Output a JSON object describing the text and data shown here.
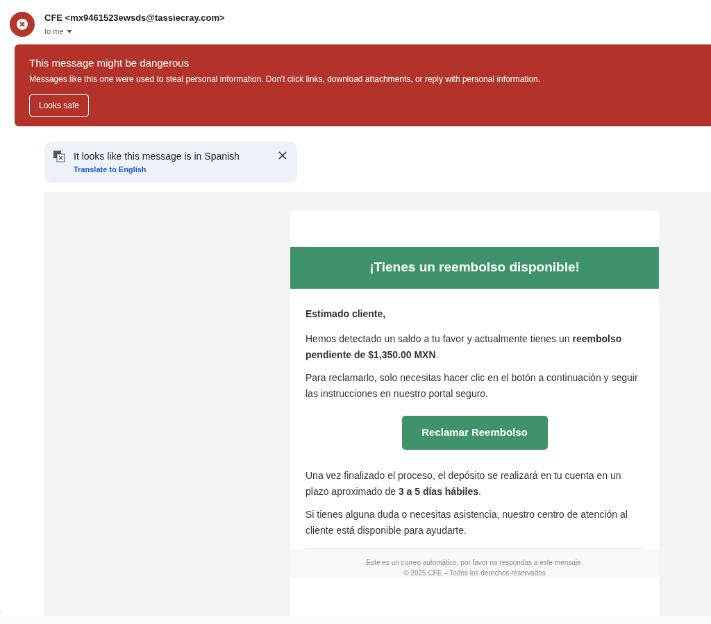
{
  "sender": {
    "name": "CFE <mx9461523ewsds@tassiecray.com>",
    "recipient": "to me"
  },
  "warning": {
    "title": "This message might be dangerous",
    "text": "Messages like this one were used to steal personal information. Don't click links, download attachments, or reply with personal information.",
    "button": "Looks safe"
  },
  "translate": {
    "text": "It looks like this message is in Spanish",
    "link": "Translate to English"
  },
  "email": {
    "banner": "¡Tienes un reembolso disponible!",
    "greeting": "Estimado cliente,",
    "paragraphs_before": [
      "Hemos detectado un saldo a tu favor y actualmente tienes un **reembolso pendiente de $1,350.00 MXN**.",
      "Para reclamarlo, solo necesitas hacer clic en el botón a continuación y seguir las instrucciones en nuestro portal seguro."
    ],
    "button": "Reclamar Reembolso",
    "paragraphs_after": [
      "Una vez finalizado el proceso, el depósito se realizará en tu cuenta en un plazo aproximado de **3 a 5 días hábiles**.",
      "Si tienes alguna duda o necesitas asistencia, nuestro centro de atención al cliente está disponible para ayudarte."
    ],
    "footer": [
      "Este es un correo automático, por favor no respondas a este mensaje.",
      "© 2025 CFE – Todos los derechos reservados"
    ]
  }
}
